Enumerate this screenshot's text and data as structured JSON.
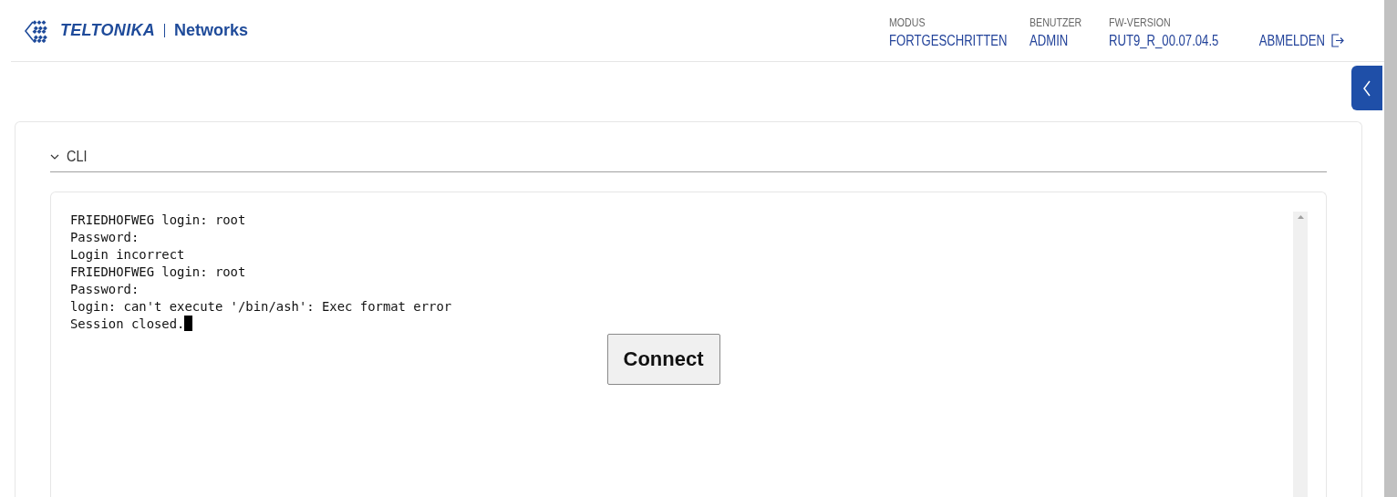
{
  "header": {
    "brand": "TELTONIKA",
    "product": "Networks",
    "info": [
      {
        "label": "MODUS",
        "value": "FORTGESCHRITTEN"
      },
      {
        "label": "BENUTZER",
        "value": "ADMIN"
      },
      {
        "label": "FW-VERSION",
        "value": "RUT9_R_00.07.04.5"
      }
    ],
    "logout": "ABMELDEN"
  },
  "section": {
    "title": "CLI",
    "expanded": true,
    "terminal": {
      "lines": [
        "FRIEDHOFWEG login: root",
        "Password:",
        "Login incorrect",
        "FRIEDHOFWEG login: root",
        "Password:",
        "login: can't execute '/bin/ash': Exec format error",
        "Session closed."
      ],
      "cursor": true,
      "button": "Connect"
    }
  }
}
